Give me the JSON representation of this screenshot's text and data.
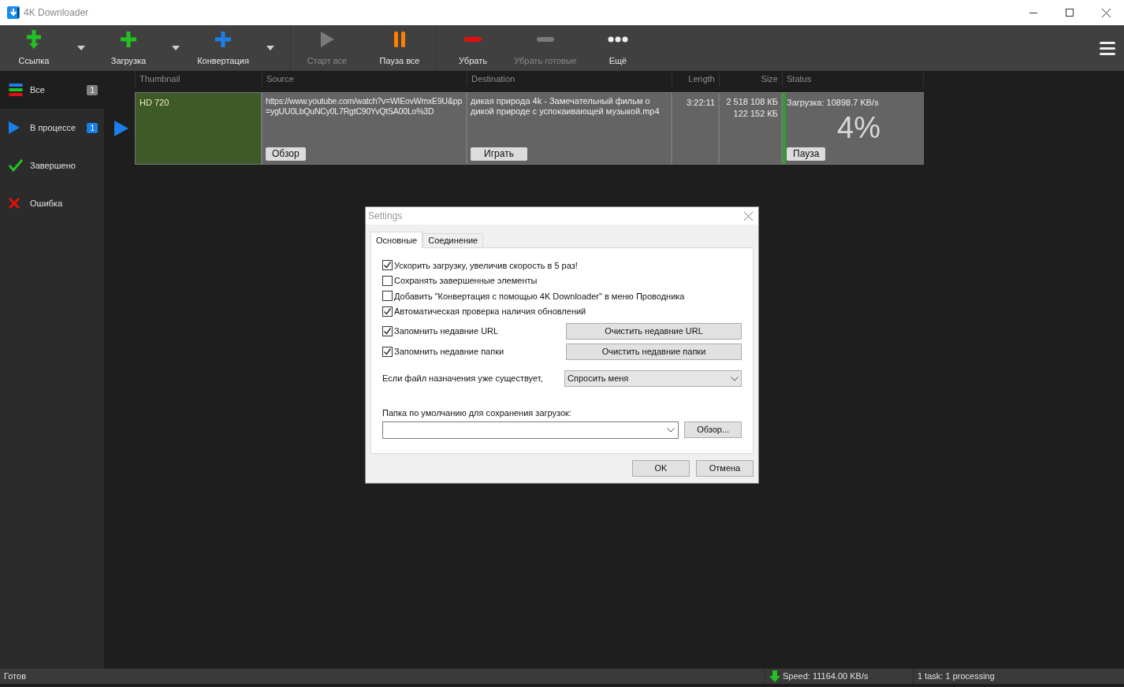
{
  "window": {
    "title": "4K Downloader"
  },
  "toolbar": [
    {
      "kind": "link",
      "label": "Ссылка",
      "dropdown": true,
      "disabled": false
    },
    {
      "kind": "download",
      "label": "Загрузка",
      "dropdown": true,
      "disabled": false
    },
    {
      "kind": "convert",
      "label": "Конвертация",
      "dropdown": true,
      "disabled": false
    },
    {
      "kind": "start",
      "label": "Старт все",
      "dropdown": false,
      "disabled": true
    },
    {
      "kind": "pause",
      "label": "Пауза все",
      "dropdown": false,
      "disabled": false
    },
    {
      "kind": "remove",
      "label": "Убрать",
      "dropdown": false,
      "disabled": false
    },
    {
      "kind": "clear",
      "label": "Убрать готовые",
      "dropdown": false,
      "disabled": true
    },
    {
      "kind": "more",
      "label": "Ещё",
      "dropdown": false,
      "disabled": false
    }
  ],
  "sidebar": {
    "items": [
      {
        "kind": "all",
        "label": "Все",
        "count": "1",
        "color": "#808080",
        "selected": true
      },
      {
        "kind": "progress",
        "label": "В процессе",
        "count": "1",
        "color": "#1a7fe8",
        "selected": false
      },
      {
        "kind": "done",
        "label": "Завершено",
        "selected": false
      },
      {
        "kind": "error",
        "label": "Ошибка",
        "selected": false
      }
    ]
  },
  "table": {
    "columns": [
      "Thumbnail",
      "Source",
      "Destination",
      "Length",
      "Size",
      "Status"
    ],
    "rows": [
      {
        "playing": true,
        "quality": "HD 720",
        "source": "https://www.youtube.com/watch?v=WIEovWmxE9U&pp=ygUU0LbQuNCy0L7RgtC90YvQtSA00Lo%3D",
        "source_button": "Обзор",
        "destination": "дикая природа 4k - Замечательный фильм о дикой природе с успокаивающей музыкой.mp4",
        "destination_button": "Играть",
        "length": "3:22:11",
        "size_total": "2 518 108 КБ",
        "size_done": "122 152 КБ",
        "status": "Загрузка: 10898.7 KB/s",
        "percent": "4%",
        "level": 0.04,
        "status_button": "Пауза"
      }
    ]
  },
  "dialog": {
    "title": "Settings",
    "tabs": [
      {
        "label": "Основные",
        "selected": true
      },
      {
        "label": "Соединение",
        "selected": false
      }
    ],
    "options": [
      {
        "label": "Ускорить загрузку, увеличив скорость в 5 раз!",
        "checked": true
      },
      {
        "label": "Сохранять завершенные элементы",
        "checked": false
      },
      {
        "label": "Добавить \"Конвертация с помощью 4K Downloader\" в меню Проводника",
        "checked": false
      },
      {
        "label": "Автоматическая проверка наличия обновлений",
        "checked": true
      }
    ],
    "history": [
      {
        "label": "Запомнить недавние URL",
        "checked": true,
        "button": "Очистить недавние URL"
      },
      {
        "label": "Запомнить недавние папки",
        "checked": true,
        "button": "Очистить недавние папки"
      }
    ],
    "exists_label": "Если файл назначения уже существует,",
    "exists_value": "Спросить меня",
    "folder_label": "Папка по умолчанию для сохранения загрузок:",
    "folder_button": "Обзор...",
    "buttons": [
      "OK",
      "Отмена"
    ]
  },
  "status_bar": {
    "left": "Готов",
    "speed": "Speed: 11164.00 KB/s",
    "tasks": "1 task: 1 processing"
  }
}
